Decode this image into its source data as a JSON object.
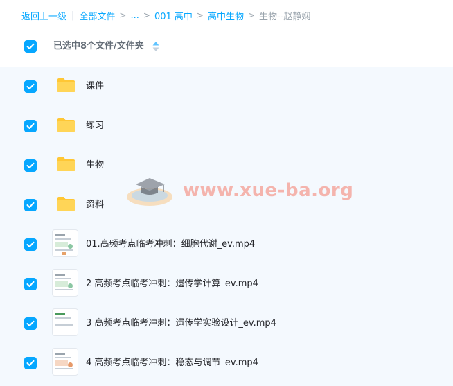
{
  "breadcrumb": {
    "back": "返回上一级",
    "divider": "|",
    "items": [
      "全部文件",
      "...",
      "001 高中",
      "高中生物"
    ],
    "separator": ">",
    "current": "生物--赵静娴"
  },
  "selection": {
    "summary": "已选中8个文件/文件夹",
    "all_checked": true
  },
  "files": [
    {
      "name": "课件",
      "type": "folder",
      "checked": true
    },
    {
      "name": "练习",
      "type": "folder",
      "checked": true
    },
    {
      "name": "生物",
      "type": "folder",
      "checked": true
    },
    {
      "name": "资料",
      "type": "folder",
      "checked": true
    },
    {
      "name": "01.高频考点临考冲刺：细胞代谢_ev.mp4",
      "type": "video",
      "checked": true
    },
    {
      "name": "2 高频考点临考冲刺：遗传学计算_ev.mp4",
      "type": "video",
      "checked": true
    },
    {
      "name": "3 高频考点临考冲刺：遗传学实验设计_ev.mp4",
      "type": "video",
      "checked": true
    },
    {
      "name": "4 高频考点临考冲刺：稳态与调节_ev.mp4",
      "type": "video",
      "checked": true
    }
  ],
  "watermark": {
    "text": "www.xue-ba.org",
    "icon": "graduation-cap-icon"
  },
  "colors": {
    "accent": "#06a7ff",
    "folder": "#ffd04b",
    "list_background": "#f4f9fe",
    "watermark": "#f4a8a0"
  }
}
